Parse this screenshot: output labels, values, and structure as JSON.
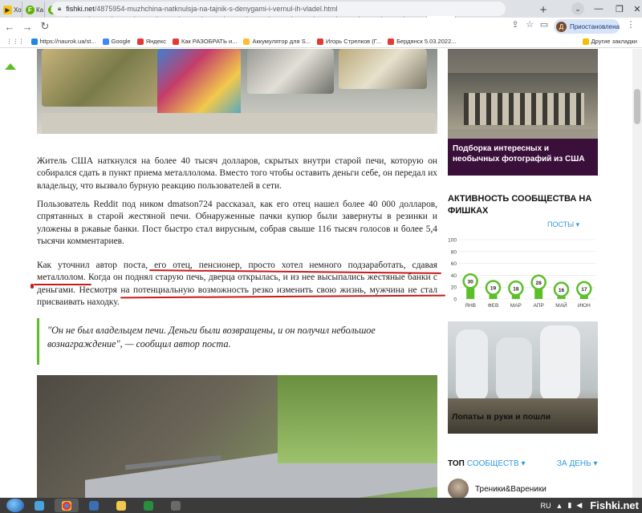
{
  "tabs": [
    {
      "label": "Хо",
      "icon": "youtube-icon"
    },
    {
      "label": "Ка",
      "icon": "fishki-icon"
    },
    {
      "label": "Ка",
      "icon": "fishki-icon"
    },
    {
      "label": "Ко",
      "icon": "fishki-icon"
    },
    {
      "label": "Тр",
      "icon": "fishki-icon"
    },
    {
      "label": "Ре",
      "icon": "fishki-icon"
    },
    {
      "label": "16",
      "icon": "fishki-icon"
    },
    {
      "label": "Ук",
      "icon": "fishki-icon"
    },
    {
      "label": "Ра",
      "icon": "fishki-icon"
    },
    {
      "label": "Ка",
      "icon": "fishki-icon"
    },
    {
      "label": "Че",
      "icon": "fishki-icon"
    },
    {
      "label": "Ис",
      "icon": "fishki-icon"
    },
    {
      "label": "Су",
      "icon": "fishki-icon"
    },
    {
      "label": "Дс",
      "icon": "fishki-icon"
    },
    {
      "label": "М",
      "icon": "fishki-icon"
    },
    {
      "label": "Ач",
      "icon": "fishki-icon"
    },
    {
      "label": "В",
      "icon": "fishki-icon"
    },
    {
      "label": "Ле",
      "icon": "fishki-icon"
    },
    {
      "label": "Пс",
      "icon": "fishki-icon"
    },
    {
      "label": "",
      "icon": "fishki-icon",
      "active": true
    }
  ],
  "toolbar": {
    "url_host": "fishki.net",
    "url_path": "/4875954-muzhchina-natknulsja-na-tajnik-s-denygami-i-vernul-ih-vladel.html",
    "profile_initial": "Д",
    "profile_label": "Приостановлена"
  },
  "bookmarks": [
    {
      "label": "https://naurok.ua/st...",
      "color": "#1e88e5"
    },
    {
      "label": "Google",
      "color": "#4285f4"
    },
    {
      "label": "Яндекс",
      "color": "#e53935"
    },
    {
      "label": "Как РАЗОБРАТЬ и...",
      "color": "#e53935"
    },
    {
      "label": "Аккумулятор для S...",
      "color": "#fbc02d"
    },
    {
      "label": "Игорь Стрелков (Г...",
      "color": "#e53935"
    },
    {
      "label": "Бердянск 5.03.2022...",
      "color": "#e53935"
    }
  ],
  "bookmarks_other": "Другие закладки",
  "article": {
    "p1": "Житель США наткнулся на более 40 тысяч долларов, скрытых внутри старой печи, которую он собирался сдать в пункт приема металлолома. Вместо того чтобы оставить деньги себе, он передал их владельцу, что вызвало бурную реакцию пользователей в сети.",
    "p2": "Пользователь Reddit под ником dmatson724 рассказал, как его отец нашел более 40 000 долларов, спрятанных в старой жестяной печи. Обнаруженные пачки купюр были завернуты в резинки и уложены в ржавые банки. Пост быстро стал вирусным, собрав свыше 116 тысяч голосов и более 5,4 тысячи комментариев.",
    "p3": "Как уточнил автор поста, его отец, пенсионер, просто хотел немного подзаработать, сдавая металлолом. Когда он поднял старую печь, дверца открылась, и из нее высыпались жестяные банки с деньгами. Несмотря на потенциальную возможность резко изменить свою жизнь, мужчина не стал присваивать находку.",
    "quote": "\"Он не был владельцем печи. Деньги были возвращены, и он получил небольшое вознаграждение\", — сообщил автор поста."
  },
  "sidebar": {
    "promo_caption": "Подборка интересных и необычных фотографий из США",
    "activity_title": "АКТИВНОСТЬ СООБЩЕСТВА НА ФИШКАХ",
    "posts_dropdown": "ПОСТЫ ▾",
    "promo2_caption": "Лопаты в руки и пошли",
    "top_label": "ТОП",
    "top_community": "СООБЩЕСТВ ▾",
    "top_period": "ЗА ДЕНЬ ▾",
    "top_user": "Треники&Вареники"
  },
  "chart_data": {
    "type": "bar",
    "categories": [
      "ЯНВ",
      "ФЕВ",
      "МАР",
      "АПР",
      "МАЙ",
      "ИЮН"
    ],
    "values": [
      30,
      19,
      18,
      28,
      16,
      17
    ],
    "yticks": [
      0,
      20,
      40,
      60,
      80,
      100
    ],
    "ylim": [
      0,
      100
    ],
    "bar_color": "#5cbf2a"
  },
  "taskbar": {
    "lang": "RU",
    "watermark": "Fishki.net"
  }
}
